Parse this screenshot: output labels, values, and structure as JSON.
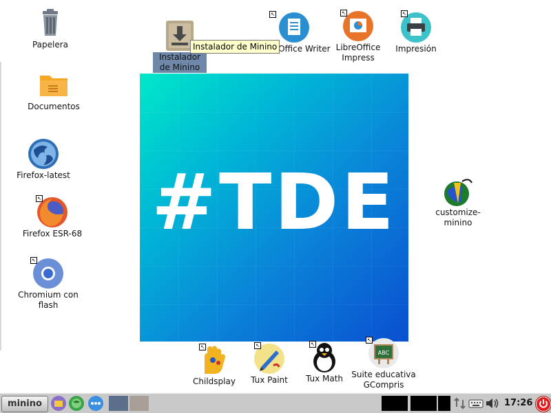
{
  "desktop": {
    "icons": [
      {
        "label": "Papelera",
        "icon": "trash-icon"
      },
      {
        "label": "Documentos",
        "icon": "folder-icon"
      },
      {
        "label": "Firefox-latest",
        "icon": "firefox-icon"
      },
      {
        "label": "Firefox ESR-68",
        "icon": "firefox-icon"
      },
      {
        "label": "Chromium con flash",
        "icon": "chromium-icon"
      },
      {
        "label": "Instalador de Minino",
        "icon": "installer-icon"
      },
      {
        "label": "LibreOffice Writer",
        "icon": "writer-icon"
      },
      {
        "label": "LibreOffice Impress",
        "icon": "impress-icon"
      },
      {
        "label": "Impresión",
        "icon": "printer-icon"
      },
      {
        "label": "customize-minino",
        "icon": "customize-icon"
      },
      {
        "label": "Childsplay",
        "icon": "childsplay-icon"
      },
      {
        "label": "Tux Paint",
        "icon": "tuxpaint-icon"
      },
      {
        "label": "Tux Math",
        "icon": "tuxmath-icon"
      },
      {
        "label": "Suite educativa GCompris",
        "icon": "gcompris-icon"
      }
    ],
    "tooltip": "Instalador de Minino",
    "wallpaper_text": "#TDE"
  },
  "taskbar": {
    "start_label": "minino",
    "clock": "17:26"
  },
  "colors": {
    "wallpaper_start": "#00e8c8",
    "wallpaper_end": "#0a4fd0",
    "taskbar_bg": "#c9c9c9",
    "selection": "#6f88a9",
    "power": "#e02020"
  }
}
